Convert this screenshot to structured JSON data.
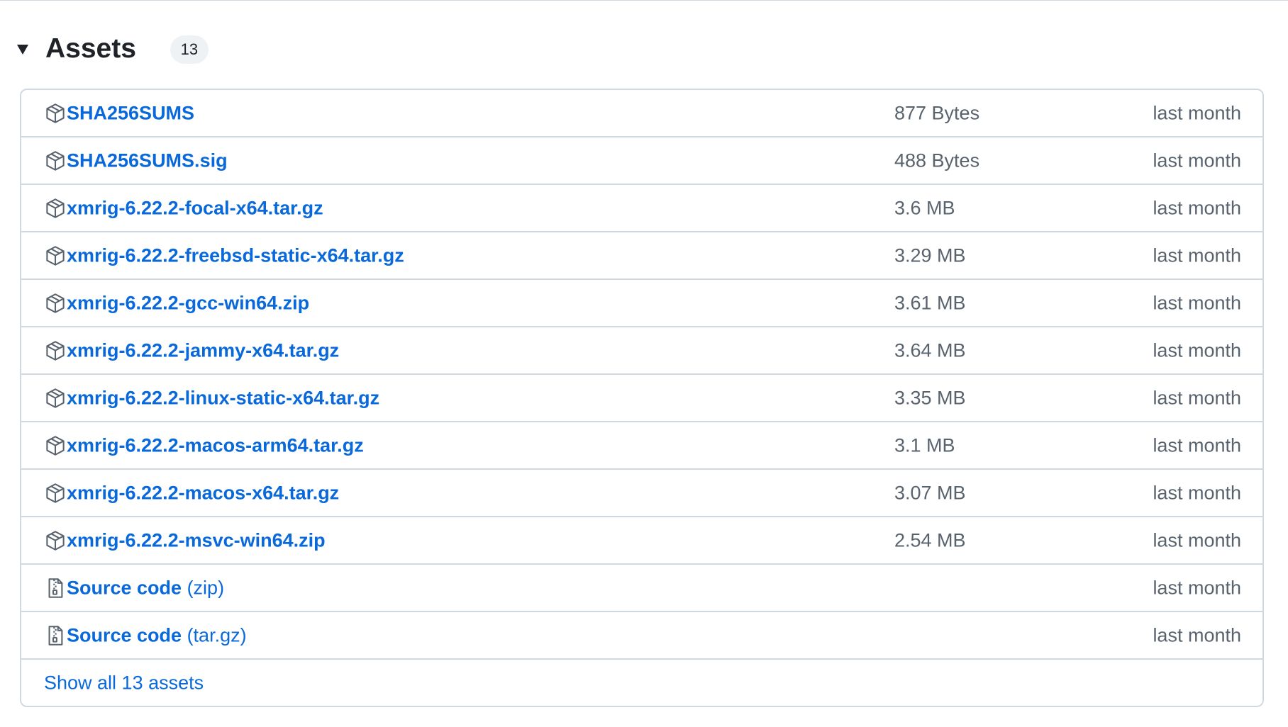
{
  "assets": {
    "title": "Assets",
    "count": "13",
    "rows": [
      {
        "name": "SHA256SUMS",
        "suffix": "",
        "size": "877 Bytes",
        "date": "last month",
        "icon": "package-icon"
      },
      {
        "name": "SHA256SUMS.sig",
        "suffix": "",
        "size": "488 Bytes",
        "date": "last month",
        "icon": "package-icon"
      },
      {
        "name": "xmrig-6.22.2-focal-x64.tar.gz",
        "suffix": "",
        "size": "3.6 MB",
        "date": "last month",
        "icon": "package-icon"
      },
      {
        "name": "xmrig-6.22.2-freebsd-static-x64.tar.gz",
        "suffix": "",
        "size": "3.29 MB",
        "date": "last month",
        "icon": "package-icon"
      },
      {
        "name": "xmrig-6.22.2-gcc-win64.zip",
        "suffix": "",
        "size": "3.61 MB",
        "date": "last month",
        "icon": "package-icon"
      },
      {
        "name": "xmrig-6.22.2-jammy-x64.tar.gz",
        "suffix": "",
        "size": "3.64 MB",
        "date": "last month",
        "icon": "package-icon"
      },
      {
        "name": "xmrig-6.22.2-linux-static-x64.tar.gz",
        "suffix": "",
        "size": "3.35 MB",
        "date": "last month",
        "icon": "package-icon"
      },
      {
        "name": "xmrig-6.22.2-macos-arm64.tar.gz",
        "suffix": "",
        "size": "3.1 MB",
        "date": "last month",
        "icon": "package-icon"
      },
      {
        "name": "xmrig-6.22.2-macos-x64.tar.gz",
        "suffix": "",
        "size": "3.07 MB",
        "date": "last month",
        "icon": "package-icon"
      },
      {
        "name": "xmrig-6.22.2-msvc-win64.zip",
        "suffix": "",
        "size": "2.54 MB",
        "date": "last month",
        "icon": "package-icon"
      },
      {
        "name": "Source code",
        "suffix": "(zip)",
        "size": "",
        "date": "last month",
        "icon": "file-zip-icon"
      },
      {
        "name": "Source code",
        "suffix": "(tar.gz)",
        "size": "",
        "date": "last month",
        "icon": "file-zip-icon"
      }
    ],
    "show_all_label": "Show all 13 assets"
  },
  "colors": {
    "link": "#0969da",
    "muted_text": "#59636e",
    "border": "#d1d9e0",
    "badge_bg": "#eff2f5",
    "heading": "#1f2328"
  }
}
